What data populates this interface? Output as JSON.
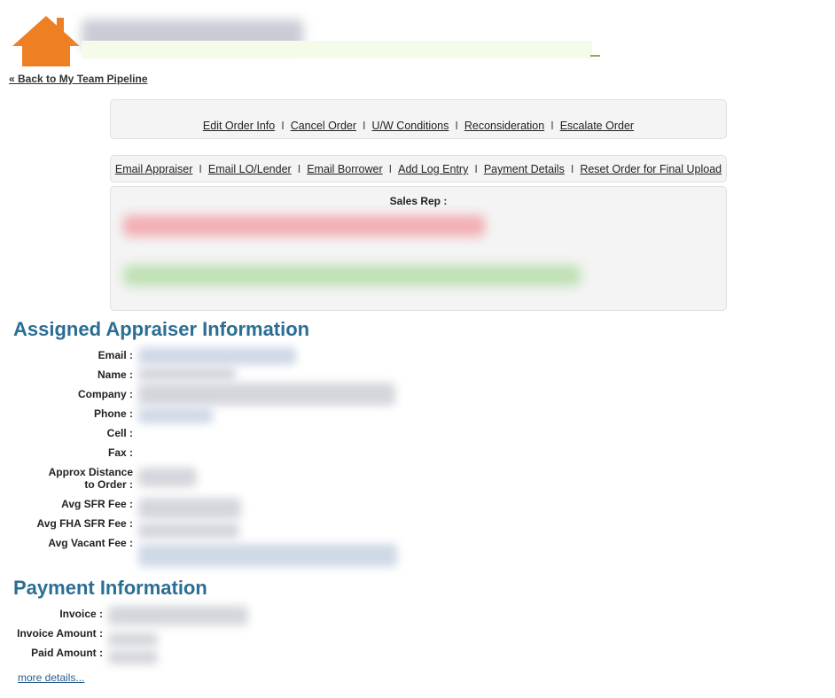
{
  "header": {
    "home_icon": "home-icon",
    "back_link": "« Back to My Team Pipeline"
  },
  "actions_primary": [
    "Edit Order Info",
    "Cancel Order",
    "U/W Conditions",
    "Reconsideration",
    "Escalate Order"
  ],
  "actions_secondary": [
    "Email Appraiser",
    "Email LO/Lender",
    "Email Borrower",
    "Add Log Entry",
    "Payment Details",
    "Reset Order for Final Upload"
  ],
  "separator": "I",
  "sales_rep": {
    "label": "Sales Rep :"
  },
  "appraiser": {
    "heading": "Assigned Appraiser Information",
    "labels": {
      "email": "Email :",
      "name": "Name :",
      "company": "Company :",
      "phone": "Phone :",
      "cell": "Cell :",
      "fax": "Fax :",
      "distance_line1": "Approx Distance",
      "distance_line2": "to Order :",
      "avg_sfr": "Avg SFR Fee :",
      "avg_fha": "Avg FHA SFR Fee :",
      "avg_vacant": "Avg Vacant Fee :"
    }
  },
  "payment": {
    "heading": "Payment Information",
    "labels": {
      "invoice": "Invoice :",
      "invoice_amount": "Invoice Amount :",
      "paid_amount": "Paid Amount :"
    },
    "more_link": "more details..."
  },
  "colors": {
    "heading": "#2b6e94",
    "home_icon": "#ee7f23",
    "link": "#2a5d8a"
  }
}
